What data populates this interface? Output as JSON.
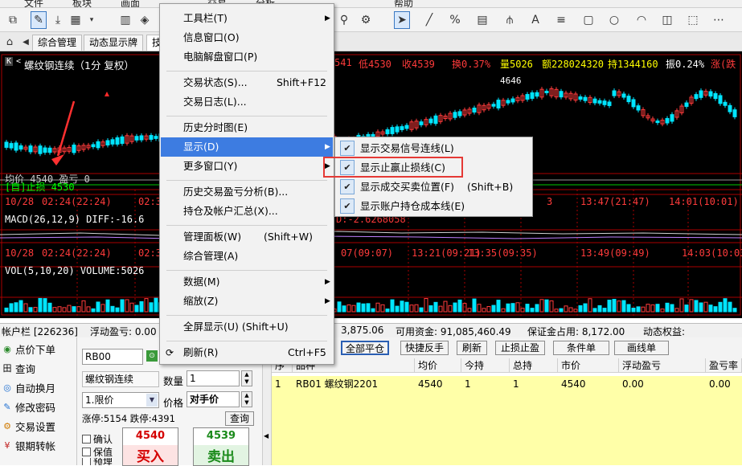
{
  "menubar": {
    "items": [
      "文件",
      "板块",
      "画面",
      "交易",
      "分析",
      "帮助"
    ]
  },
  "tabs": [
    "综合管理",
    "动态显示牌",
    "技"
  ],
  "chart": {
    "header": {
      "title": "螺纹钢连续（1分 复权）",
      "k_label": "K",
      "marker": "<",
      "low": "低4530",
      "close": "收4539",
      "turnover": "换0.37%",
      "volume": "量5026",
      "amount": "额228024320",
      "hold": "持1344160",
      "amplitude": "振0.24%",
      "change": "涨(跌"
    },
    "left_numbers": [
      "541",
      "4646"
    ],
    "avg_line": "均价 4540 盈亏 0",
    "stop_line": "[自]止损 4530",
    "time_row1": [
      "10/28",
      "02:24(22:24)",
      "02:3",
      "3",
      "13:47(21:47)",
      "14:01(10:01)"
    ],
    "macd_label": "MACD(26,12,9) DIFF:-16.6",
    "macd_tail": "D:-2.6268058",
    "time_row2": [
      "10/28",
      "02:24(22:24)",
      "02:3",
      "07(09:07)",
      "13:21(09:21)",
      "13:35(09:35)",
      "13:49(09:49)",
      "14:03(10:03)"
    ],
    "vol_label": "VOL(5,10,20) VOLUME:5026"
  },
  "account": {
    "label": "帐户栏 [226236]",
    "float_pnl": "浮动盈亏: 0.00",
    "funds": "3,875.06",
    "available": "可用资金: 91,085,460.49",
    "margin": "保证金占用: 8,172.00",
    "equity": "动态权益: 91,093,632"
  },
  "nav": [
    {
      "icon": "◉",
      "label": "点价下单"
    },
    {
      "icon": "田",
      "label": "查询"
    },
    {
      "icon": "◎",
      "label": "自动换月"
    },
    {
      "icon": "✎",
      "label": "修改密码"
    },
    {
      "icon": "⚙",
      "label": "交易设置"
    },
    {
      "icon": "¥",
      "label": "银期转帐"
    }
  ],
  "order": {
    "code": "RB00",
    "name": "螺纹钢连续",
    "qty_label": "数量",
    "qty": "1",
    "type": "1.限价",
    "price_label": "价格",
    "price": "对手价",
    "limits": "涨停:5154 跌停:4391",
    "query_btn": "查询",
    "checks": [
      "确认",
      "保值",
      "预埋"
    ],
    "buy_price": "4540",
    "sell_price": "4539",
    "buy_label": "买入",
    "sell_label": "卖出"
  },
  "actions": [
    "全部平仓",
    "快捷反手",
    "刷新",
    "止损止盈",
    "条件单",
    "画线单"
  ],
  "grid": {
    "headers": [
      "序",
      "品种",
      "均价",
      "今持",
      "总持",
      "市价",
      "浮动盈亏",
      "盈亏率"
    ],
    "row": [
      "1",
      "RB01 螺纹钢2201",
      "4540",
      "1",
      "1",
      "4540",
      "0.00",
      "0.00"
    ]
  },
  "menu": {
    "items": [
      {
        "label": "工具栏(T)",
        "shortcut": "",
        "arrow": true
      },
      {
        "label": "信息窗口(O)",
        "shortcut": "",
        "arrow": false
      },
      {
        "label": "电脑解盘窗口(P)",
        "shortcut": "",
        "arrow": false
      },
      {
        "label": "交易状态(S)...",
        "shortcut": "Shift+F12",
        "arrow": false
      },
      {
        "label": "交易日志(L)...",
        "shortcut": "",
        "arrow": false
      },
      {
        "label": "历史分时图(E)",
        "shortcut": "",
        "arrow": false
      },
      {
        "label": "显示(D)",
        "shortcut": "",
        "arrow": true
      },
      {
        "label": "更多窗口(Y)",
        "shortcut": "",
        "arrow": true
      },
      {
        "label": "历史交易盈亏分析(B)...",
        "shortcut": "",
        "arrow": false
      },
      {
        "label": "持仓及帐户汇总(X)...",
        "shortcut": "",
        "arrow": false
      },
      {
        "label": "管理面板(W)",
        "shortcut": "(Shift+W)",
        "arrow": false
      },
      {
        "label": "综合管理(A)",
        "shortcut": "",
        "arrow": false
      },
      {
        "label": "数据(M)",
        "shortcut": "",
        "arrow": true
      },
      {
        "label": "缩放(Z)",
        "shortcut": "",
        "arrow": true
      },
      {
        "label": "全屏显示(U) (Shift+U)",
        "shortcut": "",
        "arrow": false
      },
      {
        "label": "刷新(R)",
        "shortcut": "Ctrl+F5",
        "arrow": false
      }
    ]
  },
  "submenu": {
    "items": [
      {
        "label": "显示交易信号连线(L)",
        "shortcut": ""
      },
      {
        "label": "显示止赢止损线(C)",
        "shortcut": ""
      },
      {
        "label": "显示成交买卖位置(F)",
        "shortcut": "(Shift+B)"
      },
      {
        "label": "显示账户持仓成本线(E)",
        "shortcut": ""
      }
    ]
  },
  "colors": {
    "up": "#ff3b3b",
    "down": "#00e5ff",
    "stop": "#00ff00",
    "yellow": "#ffff00",
    "highlight": "#3d7ce1",
    "redbox": "#e53935"
  }
}
